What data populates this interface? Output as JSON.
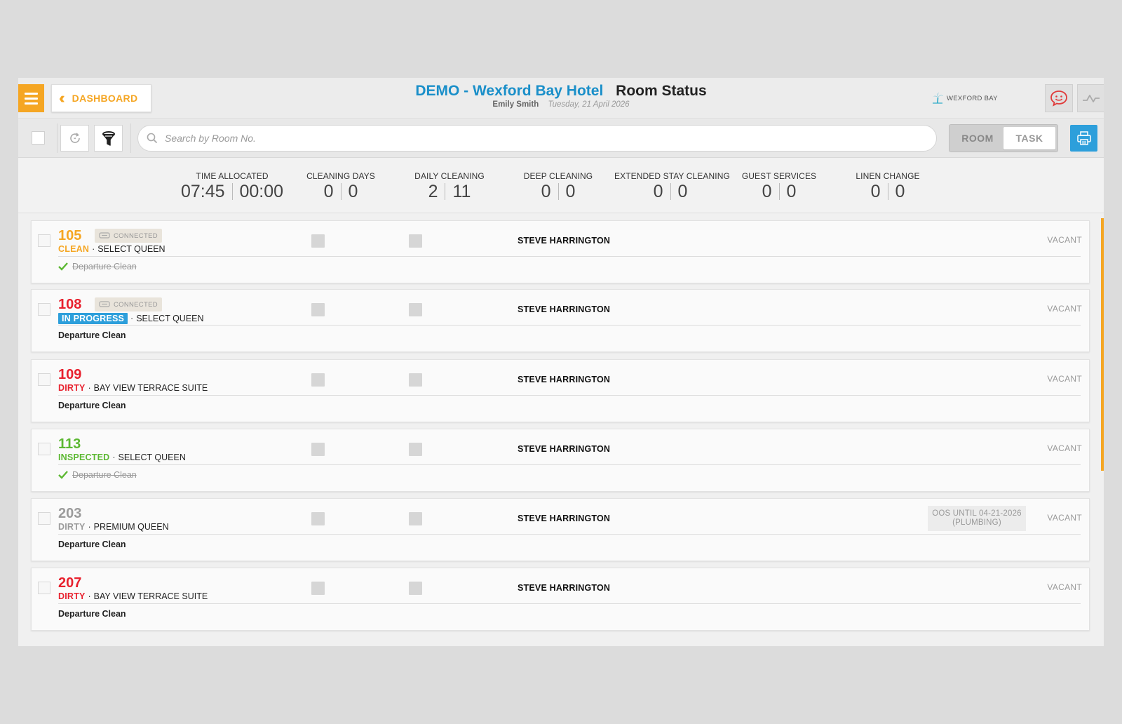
{
  "header": {
    "dashboard_label": "DASHBOARD",
    "hotel_title": "DEMO - Wexford Bay Hotel",
    "page_title": "Room Status",
    "user": "Emily Smith",
    "date": "Tuesday, 21 April 2026",
    "brand": "WEXFORD BAY",
    "icons": [
      "menu-icon",
      "double-chevron-left-icon",
      "chat-smiley-icon",
      "activity-pulse-icon",
      "palm-tree-icon"
    ],
    "colors": {
      "accent": "#f5a623",
      "title_blue": "#1a8fc9",
      "chat_red": "#e03b3b"
    }
  },
  "toolbar": {
    "search_placeholder": "Search by Room No.",
    "toggle": {
      "room_label": "ROOM",
      "task_label": "TASK",
      "active": "TASK"
    },
    "icons": [
      "refresh-icon",
      "filter-funnel-icon",
      "search-icon",
      "printer-icon"
    ]
  },
  "summary": [
    {
      "label": "TIME ALLOCATED",
      "a": "07:45",
      "b": "00:00"
    },
    {
      "label": "CLEANING DAYS",
      "a": "0",
      "b": "0"
    },
    {
      "label": "DAILY CLEANING",
      "a": "2",
      "b": "11"
    },
    {
      "label": "DEEP CLEANING",
      "a": "0",
      "b": "0"
    },
    {
      "label": "EXTENDED STAY CLEANING",
      "a": "0",
      "b": "0"
    },
    {
      "label": "GUEST SERVICES",
      "a": "0",
      "b": "0"
    },
    {
      "label": "LINEN CHANGE",
      "a": "0",
      "b": "0"
    }
  ],
  "rooms": [
    {
      "number": "105",
      "number_color": "#f5a623",
      "connected": "CONNECTED",
      "status": "CLEAN",
      "status_color": "#f5a623",
      "room_type": "SELECT QUEEN",
      "task": "Departure Clean",
      "task_done": true,
      "attendant": "STEVE HARRINGTON",
      "occupancy": "VACANT"
    },
    {
      "number": "108",
      "number_color": "#e8212e",
      "connected": "CONNECTED",
      "status": "IN PROGRESS",
      "status_color": "#2d9fdb",
      "status_pill": true,
      "room_type": "SELECT QUEEN",
      "task": "Departure Clean",
      "task_done": false,
      "attendant": "STEVE HARRINGTON",
      "occupancy": "VACANT"
    },
    {
      "number": "109",
      "number_color": "#e8212e",
      "status": "DIRTY",
      "status_color": "#e8212e",
      "room_type": "BAY VIEW TERRACE SUITE",
      "task": "Departure Clean",
      "task_done": false,
      "attendant": "STEVE HARRINGTON",
      "occupancy": "VACANT"
    },
    {
      "number": "113",
      "number_color": "#5cb832",
      "status": "INSPECTED",
      "status_color": "#5cb832",
      "room_type": "SELECT QUEEN",
      "task": "Departure Clean",
      "task_done": true,
      "attendant": "STEVE HARRINGTON",
      "occupancy": "VACANT"
    },
    {
      "number": "203",
      "number_color": "#9b9b9b",
      "status": "DIRTY",
      "status_color": "#9b9b9b",
      "room_type": "PREMIUM QUEEN",
      "task": "Departure Clean",
      "task_done": false,
      "attendant": "STEVE HARRINGTON",
      "occupancy": "VACANT",
      "oos_line1": "OOS UNTIL 04-21-2026",
      "oos_line2": "(PLUMBING)"
    },
    {
      "number": "207",
      "number_color": "#e8212e",
      "status": "DIRTY",
      "status_color": "#e8212e",
      "room_type": "BAY VIEW TERRACE SUITE",
      "task": "Departure Clean",
      "task_done": false,
      "attendant": "STEVE HARRINGTON",
      "occupancy": "VACANT"
    }
  ]
}
